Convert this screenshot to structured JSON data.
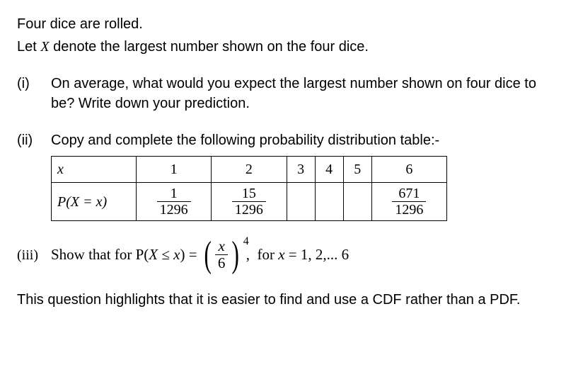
{
  "intro": {
    "line1": "Four dice are rolled.",
    "line2_a": "Let ",
    "line2_var": "X",
    "line2_b": " denote the largest number shown on the four dice."
  },
  "parts": {
    "i": {
      "label": "(i)",
      "text": "On average, what would you expect the largest number shown on four dice to be? Write down your prediction."
    },
    "ii": {
      "label": "(ii)",
      "text": "Copy and complete the following probability distribution table:-",
      "table": {
        "row1_header": "x",
        "cols": [
          "1",
          "2",
          "3",
          "4",
          "5",
          "6"
        ],
        "row2_header": "P(X = x)",
        "cells": [
          {
            "num": "1",
            "den": "1296"
          },
          {
            "num": "15",
            "den": "1296"
          },
          null,
          null,
          null,
          {
            "num": "671",
            "den": "1296"
          }
        ]
      }
    },
    "iii": {
      "label": "(iii)",
      "lead": "Show that for P(X ≤ x) = ",
      "frac_num": "x",
      "frac_den": "6",
      "exp": "4",
      "tail": " ,  for x = 1, 2,... 6"
    }
  },
  "footer": "This question highlights that it is easier to find and use a CDF rather than a PDF."
}
